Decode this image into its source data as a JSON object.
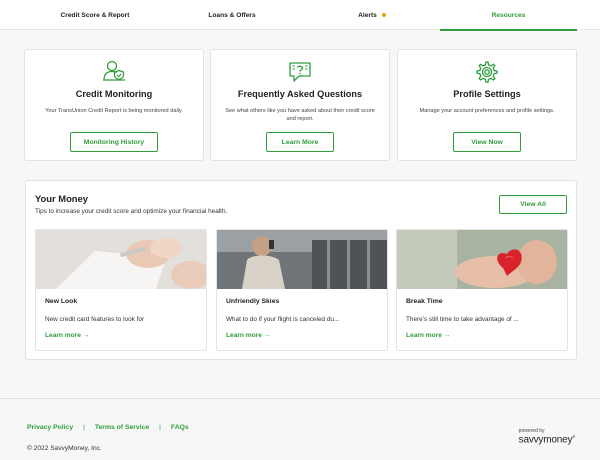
{
  "tabs": [
    {
      "label": "Credit Score & Report"
    },
    {
      "label": "Loans & Offers"
    },
    {
      "label": "Alerts"
    },
    {
      "label": "Resources"
    }
  ],
  "cards": [
    {
      "icon": "person-shield-icon",
      "title": "Credit Monitoring",
      "desc": "Your TransUnion Credit Report is being monitored daily.",
      "button": "Monitoring History"
    },
    {
      "icon": "chat-question-icon",
      "title": "Frequently Asked Questions",
      "desc": "See what others like you have asked about their credit score and report.",
      "button": "Learn More"
    },
    {
      "icon": "gear-icon",
      "title": "Profile Settings",
      "desc": "Manage your account preferences and profile settings.",
      "button": "View Now"
    }
  ],
  "money": {
    "title": "Your Money",
    "subtitle": "Tips to increase your credit score and optimize your financial health.",
    "view_all": "View All",
    "articles": [
      {
        "title": "New Look",
        "desc": "New credit card features to look for",
        "more": "Learn more"
      },
      {
        "title": "Unfriendly Skies",
        "desc": "What to do if your flight is canceled du...",
        "more": "Learn more"
      },
      {
        "title": "Break Time",
        "desc": "There's still time to take advantage of ...",
        "more": "Learn more"
      }
    ]
  },
  "footer": {
    "links": [
      "Privacy Policy",
      "Terms of Service",
      "FAQs"
    ],
    "separator": "|",
    "copyright": "© 2022 SavvyMoney, Inc.",
    "powered_by": "powered by",
    "brand": "savvymoney"
  },
  "colors": {
    "accent": "#2e9d3a",
    "alert_dot": "#f39c12"
  }
}
